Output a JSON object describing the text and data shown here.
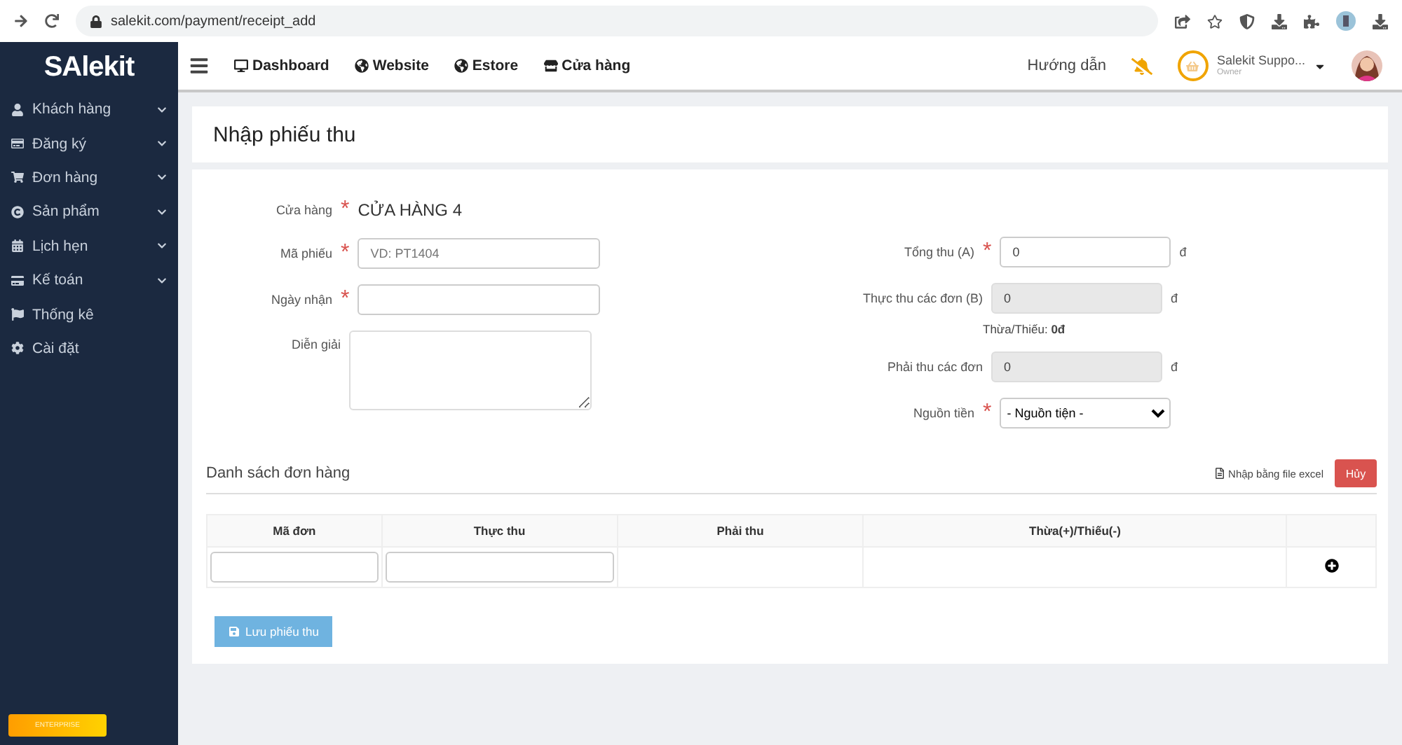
{
  "browser": {
    "url": "salekit.com/payment/receipt_add"
  },
  "sidebar": {
    "logo": "SAlekit",
    "items": [
      {
        "label": "Khách hàng",
        "has_submenu": true
      },
      {
        "label": "Đăng ký",
        "has_submenu": true
      },
      {
        "label": "Đơn hàng",
        "has_submenu": true
      },
      {
        "label": "Sản phẩm",
        "has_submenu": true
      },
      {
        "label": "Lịch hẹn",
        "has_submenu": true
      },
      {
        "label": "Kế toán",
        "has_submenu": true
      },
      {
        "label": "Thống kê",
        "has_submenu": false
      },
      {
        "label": "Cài đặt",
        "has_submenu": false
      }
    ],
    "badge": "ENTERPRISE"
  },
  "topbar": {
    "nav": [
      {
        "label": "Dashboard"
      },
      {
        "label": "Website"
      },
      {
        "label": "Estore"
      },
      {
        "label": "Cửa hàng"
      }
    ],
    "help": "Hướng dẫn",
    "user": {
      "name": "Salekit Suppo...",
      "role": "Owner"
    }
  },
  "page": {
    "title": "Nhập phiếu thu"
  },
  "form": {
    "store": {
      "label": "Cửa hàng",
      "required_mark": "*",
      "value": "CỬA HÀNG 4"
    },
    "left_fields": [
      {
        "kind": "text",
        "label": "Mã phiếu",
        "required_mark": "*",
        "placeholder": "VD: PT1404"
      },
      {
        "kind": "text",
        "label": "Ngày nhận",
        "required_mark": "*"
      },
      {
        "kind": "textarea",
        "label": "Diễn giải"
      }
    ],
    "right_fields": [
      {
        "kind": "text",
        "label": "Tổng thu (A)",
        "required_mark": "*",
        "value": "0",
        "readonly": false,
        "suffix": "đ"
      },
      {
        "kind": "text",
        "label": "Thực thu các đơn (B)",
        "value": "0",
        "readonly": true,
        "suffix": "đ",
        "note": "Thừa/Thiếu: **0đ**"
      },
      {
        "kind": "text",
        "label": "Phải thu các đơn",
        "value": "0",
        "readonly": true,
        "suffix": "đ"
      },
      {
        "kind": "select",
        "label": "Nguồn tiền",
        "required_mark": "*",
        "value": "- Nguồn tiện -"
      }
    ]
  },
  "orders": {
    "title": "Danh sách đơn hàng",
    "import": "Nhập bằng file excel",
    "cancel": "Hủy",
    "columns": [
      "Mã đơn",
      "Thực thu",
      "Phải thu",
      "Thừa(+)/Thiếu(-)"
    ],
    "save": "Lưu phiếu thu"
  }
}
